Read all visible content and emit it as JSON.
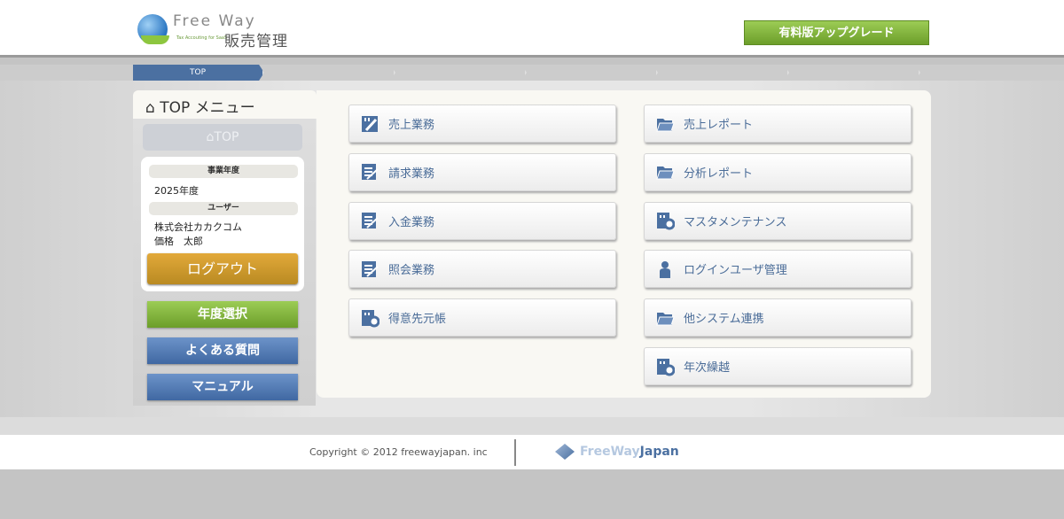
{
  "header": {
    "logo_en": "Free Way",
    "logo_sub": "Tax Accouting for SaaS",
    "logo_jp": "販売管理",
    "upgrade": "有料版アップグレード"
  },
  "breadcrumb": [
    "TOP",
    "",
    "",
    "",
    "",
    ""
  ],
  "sidebar": {
    "tab_title": "⌂ TOP メニュー",
    "top_button": "⌂TOP",
    "fiscal_label": "事業年度",
    "fiscal_value": "2025年度",
    "user_label": "ユーザー",
    "company": "株式会社カカクコム",
    "user_name": "価格　太郎",
    "logout": "ログアウト",
    "year_select": "年度選択",
    "faq": "よくある質問",
    "manual": "マニュアル"
  },
  "menu": {
    "left": [
      {
        "label": "売上業務",
        "icon": "pen"
      },
      {
        "label": "請求業務",
        "icon": "list"
      },
      {
        "label": "入金業務",
        "icon": "list"
      },
      {
        "label": "照会業務",
        "icon": "list"
      },
      {
        "label": "得意先元帳",
        "icon": "building"
      }
    ],
    "right": [
      {
        "label": "売上レポート",
        "icon": "folder"
      },
      {
        "label": "分析レポート",
        "icon": "folder"
      },
      {
        "label": "マスタメンテナンス",
        "icon": "building"
      },
      {
        "label": "ログインユーザ管理",
        "icon": "person"
      },
      {
        "label": "他システム連携",
        "icon": "folder"
      },
      {
        "label": "年次繰越",
        "icon": "building"
      }
    ]
  },
  "footer": {
    "copyright": "Copyright © 2012 freewayjapan. inc",
    "logo_a": "FreeWay",
    "logo_b": "Japan"
  },
  "colors": {
    "accent": "#4b70a1",
    "green": "#7fb23a",
    "gold": "#d19a2d"
  }
}
